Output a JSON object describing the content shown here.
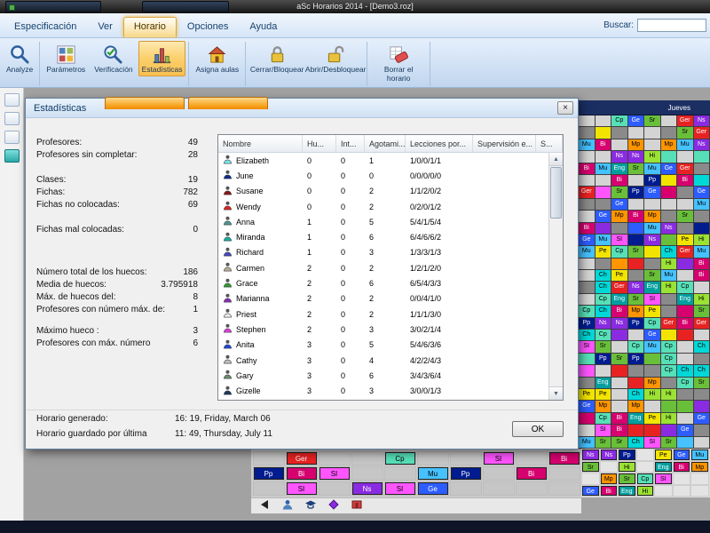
{
  "window": {
    "title": "aSc Horarios 2014 - [Demo3.roz]"
  },
  "menu": {
    "tabs": [
      {
        "label": "Especificación",
        "active": false
      },
      {
        "label": "Ver",
        "active": false
      },
      {
        "label": "Horario",
        "active": true
      },
      {
        "label": "Opciones",
        "active": false
      },
      {
        "label": "Ayuda",
        "active": false
      }
    ],
    "search_label": "Buscar:"
  },
  "ribbon": {
    "buttons": [
      {
        "label": "Analyze",
        "icon": "magnifier-icon",
        "active": false,
        "sep_after": true
      },
      {
        "label": "Parámetros",
        "icon": "parameters-icon",
        "active": false,
        "sep_after": false
      },
      {
        "label": "Verificación",
        "icon": "verification-icon",
        "active": false,
        "sep_after": false
      },
      {
        "label": "Estadísticas",
        "icon": "statistics-icon",
        "active": true,
        "sep_after": true
      },
      {
        "label": "Asigna aulas",
        "icon": "rooms-icon",
        "active": false,
        "sep_after": true
      },
      {
        "label": "Cerrar/Bloquear",
        "icon": "lock-icon",
        "active": false,
        "sep_after": false
      },
      {
        "label": "Abrir/Desbloquear",
        "icon": "unlock-icon",
        "active": false,
        "sep_after": true
      },
      {
        "label": "Borrar el horario",
        "icon": "eraser-icon",
        "active": false,
        "sep_after": true
      }
    ]
  },
  "dialog": {
    "title": "Estadísticas",
    "close_icon": "×",
    "ok_label": "OK",
    "stats": [
      {
        "label": "Profesores:",
        "value": "49",
        "mt": 0
      },
      {
        "label": "Profesores sin completar:",
        "value": "28",
        "mt": 0
      },
      {
        "label": "Clases:",
        "value": "19",
        "mt": 14
      },
      {
        "label": "Fichas:",
        "value": "782",
        "mt": 0
      },
      {
        "label": "Fichas no colocadas:",
        "value": "69",
        "mt": 0
      },
      {
        "label": "Fichas mal colocadas:",
        "value": "0",
        "mt": 14
      },
      {
        "label": "Número total de los huecos:",
        "value": "186",
        "mt": 34
      },
      {
        "label": "Media de huecos:",
        "value": "3.795918",
        "mt": 0
      },
      {
        "label": "Máx. de huecos del:",
        "value": "8",
        "mt": 0
      },
      {
        "label": "Profesores con número máx. de:",
        "value": "1",
        "mt": 0
      },
      {
        "label": "Máximo hueco :",
        "value": "3",
        "mt": 10
      },
      {
        "label": "Profesores con máx. número",
        "value": "6",
        "mt": 0
      }
    ],
    "table": {
      "columns": [
        "Nombre",
        "Hu...",
        "Int...",
        "Agotami...",
        "Lecciones por...",
        "Supervisión e...",
        "S..."
      ],
      "rows": [
        {
          "name": "Elizabeth",
          "color": "#7de8f0",
          "huecos": "0",
          "int": "0",
          "agotamiento": "1",
          "lecciones": "1/0/0/1/1",
          "supervision": ""
        },
        {
          "name": "June",
          "color": "#0b2f8c",
          "huecos": "0",
          "int": "0",
          "agotamiento": "0",
          "lecciones": "0/0/0/0/0",
          "supervision": ""
        },
        {
          "name": "Susane",
          "color": "#8c1616",
          "huecos": "0",
          "int": "0",
          "agotamiento": "2",
          "lecciones": "1/1/2/0/2",
          "supervision": ""
        },
        {
          "name": "Wendy",
          "color": "#e32424",
          "huecos": "0",
          "int": "0",
          "agotamiento": "2",
          "lecciones": "0/2/0/1/2",
          "supervision": ""
        },
        {
          "name": "Anna",
          "color": "#4f9898",
          "huecos": "1",
          "int": "0",
          "agotamiento": "5",
          "lecciones": "5/4/1/5/4",
          "supervision": ""
        },
        {
          "name": "Miranda",
          "color": "#17b2a6",
          "huecos": "1",
          "int": "0",
          "agotamiento": "6",
          "lecciones": "6/4/6/6/2",
          "supervision": ""
        },
        {
          "name": "Richard",
          "color": "#4848c4",
          "huecos": "1",
          "int": "0",
          "agotamiento": "3",
          "lecciones": "1/3/3/1/3",
          "supervision": ""
        },
        {
          "name": "Carmen",
          "color": "#b8b09a",
          "huecos": "2",
          "int": "0",
          "agotamiento": "2",
          "lecciones": "1/2/1/2/0",
          "supervision": ""
        },
        {
          "name": "Grace",
          "color": "#2f9e2f",
          "huecos": "2",
          "int": "0",
          "agotamiento": "6",
          "lecciones": "6/5/4/3/3",
          "supervision": ""
        },
        {
          "name": "Marianna",
          "color": "#8c2fb8",
          "huecos": "2",
          "int": "0",
          "agotamiento": "2",
          "lecciones": "0/0/4/1/0",
          "supervision": ""
        },
        {
          "name": "Priest",
          "color": "#efefef",
          "huecos": "2",
          "int": "0",
          "agotamiento": "2",
          "lecciones": "1/1/1/3/0",
          "supervision": ""
        },
        {
          "name": "Stephen",
          "color": "#e23ee2",
          "huecos": "2",
          "int": "0",
          "agotamiento": "3",
          "lecciones": "3/0/2/1/4",
          "supervision": ""
        },
        {
          "name": "Anita",
          "color": "#2248dc",
          "huecos": "3",
          "int": "0",
          "agotamiento": "5",
          "lecciones": "5/4/6/3/6",
          "supervision": ""
        },
        {
          "name": "Cathy",
          "color": "#c0c0c0",
          "huecos": "3",
          "int": "0",
          "agotamiento": "4",
          "lecciones": "4/2/2/4/3",
          "supervision": ""
        },
        {
          "name": "Gary",
          "color": "#6f8f6f",
          "huecos": "3",
          "int": "0",
          "agotamiento": "6",
          "lecciones": "3/4/3/6/4",
          "supervision": ""
        },
        {
          "name": "Gizelle",
          "color": "#1a3a5c",
          "huecos": "3",
          "int": "0",
          "agotamiento": "3",
          "lecciones": "3/0/0/1/3",
          "supervision": ""
        }
      ]
    },
    "footer": [
      {
        "label": "Horario generado:",
        "value": "16: 19, Friday, March 06"
      },
      {
        "label": "Horario guardado por última",
        "value": "11: 49, Thursday, July 11"
      }
    ]
  },
  "background": {
    "day_header": "Jueves",
    "palette": [
      {
        "label": "Eng",
        "color": "#009e9e"
      },
      {
        "label": "Ch",
        "color": "#00d8d8"
      },
      {
        "label": "SI",
        "color": "#ff55ff"
      },
      {
        "label": "Pe",
        "color": "#f2e400"
      },
      {
        "label": "Ns",
        "color": "#8a2be2"
      },
      {
        "label": "Mp",
        "color": "#ff9500"
      },
      {
        "label": "Ge",
        "color": "#2d5cff"
      },
      {
        "label": "Ger",
        "color": "#e82222"
      },
      {
        "label": "Pp",
        "color": "#001c8f"
      },
      {
        "label": "Cp",
        "color": "#57e0b8"
      },
      {
        "label": "Sr",
        "color": "#6abf3a"
      },
      {
        "label": "Bi",
        "color": "#d6006e"
      },
      {
        "label": "Hi",
        "color": "#9be234"
      },
      {
        "label": "Mu",
        "color": "#45c2ff"
      }
    ],
    "status_icon_names": [
      "collapse-arrow-icon",
      "teacher-filter-icon",
      "class-filter-icon",
      "subject-filter-icon",
      "room-filter-icon"
    ]
  },
  "ui": {
    "arrow_up": "▲",
    "arrow_down": "▼"
  }
}
